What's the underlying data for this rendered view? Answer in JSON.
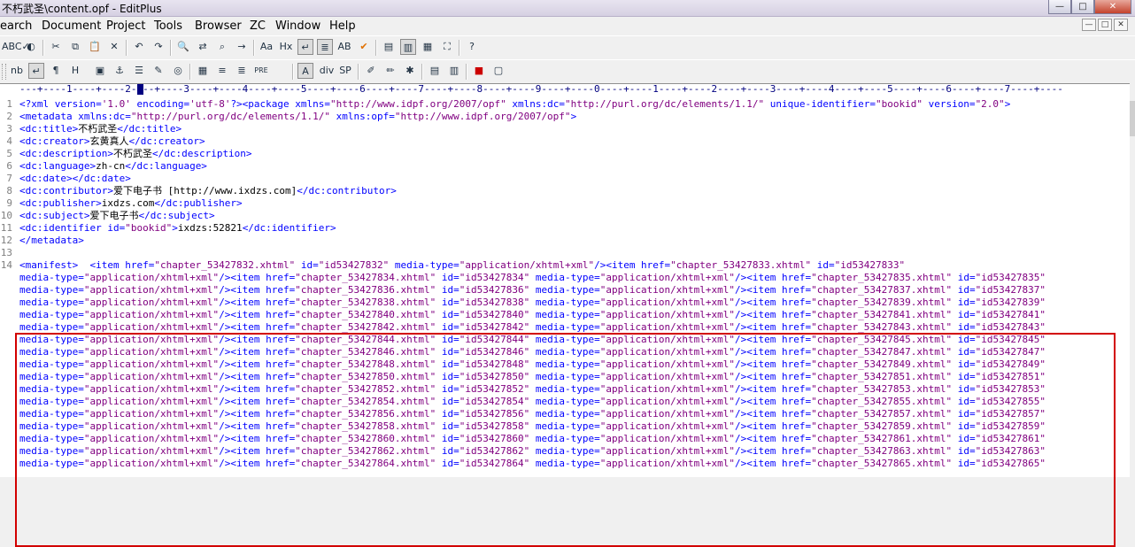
{
  "window": {
    "title": "不朽武圣\\content.opf - EditPlus",
    "controls": [
      "—",
      "□",
      "✕"
    ]
  },
  "menu": [
    "earch",
    "Document",
    "Project",
    "Tools",
    "Browser",
    "ZC",
    "Window",
    "Help"
  ],
  "mdi_controls": [
    "—",
    "□",
    "✕"
  ],
  "toolbar1": [
    {
      "name": "spellcheck-icon",
      "label": "ABC✓"
    },
    {
      "name": "browser-view-icon",
      "label": "◐"
    },
    {
      "name": "cut-icon",
      "label": "✂"
    },
    {
      "name": "copy-icon",
      "label": "⧉"
    },
    {
      "name": "paste-icon",
      "label": "📋"
    },
    {
      "name": "delete-icon",
      "label": "✕"
    },
    {
      "name": "undo-icon",
      "label": "↶"
    },
    {
      "name": "redo-icon",
      "label": "↷"
    },
    {
      "name": "find-icon",
      "label": "🔍"
    },
    {
      "name": "replace-icon",
      "label": "⇄"
    },
    {
      "name": "find-in-files-icon",
      "label": "⌕"
    },
    {
      "name": "goto-icon",
      "label": "→"
    },
    {
      "name": "font-icon",
      "label": "Aa"
    },
    {
      "name": "hex-viewer-icon",
      "label": "Hx"
    },
    {
      "name": "word-wrap-icon",
      "label": "↵"
    },
    {
      "name": "column-mode-icon",
      "label": "≣"
    },
    {
      "name": "sort-icon",
      "label": "AB"
    },
    {
      "name": "check-icon",
      "label": "✔"
    },
    {
      "name": "document-selector-icon",
      "label": "▤"
    },
    {
      "name": "output-window-icon",
      "label": "▥"
    },
    {
      "name": "cliptext-icon",
      "label": "▦"
    },
    {
      "name": "fullscreen-icon",
      "label": "⛶"
    },
    {
      "name": "help-icon",
      "label": "?"
    }
  ],
  "toolbar2": [
    {
      "name": "nbsp-icon",
      "label": "nb"
    },
    {
      "name": "br-icon",
      "label": "↵"
    },
    {
      "name": "paragraph-icon",
      "label": "¶"
    },
    {
      "name": "heading-icon",
      "label": "H"
    },
    {
      "name": "image-icon",
      "label": "▣"
    },
    {
      "name": "anchor-icon",
      "label": "⚓"
    },
    {
      "name": "hr-icon",
      "label": "☰"
    },
    {
      "name": "edit-icon",
      "label": "✎"
    },
    {
      "name": "color-icon",
      "label": "◎"
    },
    {
      "name": "table-icon",
      "label": "▦"
    },
    {
      "name": "list-icon",
      "label": "≡"
    },
    {
      "name": "center-icon",
      "label": "≣"
    },
    {
      "name": "pre-icon",
      "label": "PRE"
    },
    {
      "name": "font-tag-icon",
      "label": "A"
    },
    {
      "name": "div-icon",
      "label": "div"
    },
    {
      "name": "span-icon",
      "label": "SP"
    },
    {
      "name": "form-icon",
      "label": "✐"
    },
    {
      "name": "style-icon",
      "label": "✏"
    },
    {
      "name": "script-icon",
      "label": "✱"
    },
    {
      "name": "preview-icon",
      "label": "▤"
    },
    {
      "name": "frame-icon",
      "label": "▥"
    },
    {
      "name": "color-picker-icon",
      "label": "■"
    },
    {
      "name": "panel-icon",
      "label": "▢"
    }
  ],
  "ruler": "---+----1----+----2----+----3----+----4----+----5----+----6----+----7----+----8----+----9----+----0----+----1----+----2----+----3----+----4----+----5----+----6----+----7----+----",
  "line_numbers": [
    "1",
    "2",
    "3",
    "4",
    "5",
    "6",
    "7",
    "8",
    "9",
    "10",
    "11",
    "12",
    "13",
    "14"
  ],
  "colors": {
    "tag": "#0000ff",
    "attr": "#0000ff",
    "value": "#800080",
    "text": "#000000",
    "highlight_box": "#d20000"
  },
  "code_lines": [
    [
      [
        "tag",
        "<?xml version="
      ],
      [
        "value",
        "'1.0'"
      ],
      [
        "tag",
        " encoding="
      ],
      [
        "value",
        "'utf-8'"
      ],
      [
        "tag",
        "?><package xmlns="
      ],
      [
        "value",
        "\"http://www.idpf.org/2007/opf\""
      ],
      [
        "tag",
        " xmlns:dc="
      ],
      [
        "value",
        "\"http://purl.org/dc/elements/1.1/\""
      ],
      [
        "tag",
        " unique-identifier="
      ],
      [
        "value",
        "\"bookid\""
      ],
      [
        "tag",
        " version="
      ],
      [
        "value",
        "\"2.0\""
      ],
      [
        "tag",
        ">"
      ]
    ],
    [
      [
        "tag",
        "<metadata xmlns:dc="
      ],
      [
        "value",
        "\"http://purl.org/dc/elements/1.1/\""
      ],
      [
        "tag",
        " xmlns:opf="
      ],
      [
        "value",
        "\"http://www.idpf.org/2007/opf\""
      ],
      [
        "tag",
        ">"
      ]
    ],
    [
      [
        "tag",
        "<dc:title>"
      ],
      [
        "text",
        "不朽武圣"
      ],
      [
        "tag",
        "</dc:title>"
      ]
    ],
    [
      [
        "tag",
        "<dc:creator>"
      ],
      [
        "text",
        "玄黄真人"
      ],
      [
        "tag",
        "</dc:creator>"
      ]
    ],
    [
      [
        "tag",
        "<dc:description>"
      ],
      [
        "text",
        "不朽武圣"
      ],
      [
        "tag",
        "</dc:description>"
      ]
    ],
    [
      [
        "tag",
        "<dc:language>"
      ],
      [
        "text",
        "zh-cn"
      ],
      [
        "tag",
        "</dc:language>"
      ]
    ],
    [
      [
        "tag",
        "<dc:date></dc:date>"
      ]
    ],
    [
      [
        "tag",
        "<dc:contributor>"
      ],
      [
        "text",
        "爱下电子书 [http://www.ixdzs.com]"
      ],
      [
        "tag",
        "</dc:contributor>"
      ]
    ],
    [
      [
        "tag",
        "<dc:publisher>"
      ],
      [
        "text",
        "ixdzs.com"
      ],
      [
        "tag",
        "</dc:publisher>"
      ]
    ],
    [
      [
        "tag",
        "<dc:subject>"
      ],
      [
        "text",
        "爱下电子书"
      ],
      [
        "tag",
        "</dc:subject>"
      ]
    ],
    [
      [
        "tag",
        "<dc:identifier id="
      ],
      [
        "value",
        "\"bookid\""
      ],
      [
        "tag",
        ">"
      ],
      [
        "text",
        "ixdzs:52821"
      ],
      [
        "tag",
        "</dc:identifier>"
      ]
    ],
    [
      [
        "tag",
        "</metadata>"
      ]
    ],
    [],
    [
      [
        "tag",
        "<manifest>  <item href="
      ],
      [
        "value",
        "\"chapter_53427832.xhtml\""
      ],
      [
        "tag",
        " id="
      ],
      [
        "value",
        "\"id53427832\""
      ],
      [
        "tag",
        " media-type="
      ],
      [
        "value",
        "\"application/xhtml+xml\""
      ],
      [
        "tag",
        "/><item href="
      ],
      [
        "value",
        "\"chapter_53427833.xhtml\""
      ],
      [
        "tag",
        " id="
      ],
      [
        "value",
        "\"id53427833\""
      ]
    ],
    [
      [
        "tag",
        "media-type="
      ],
      [
        "value",
        "\"application/xhtml+xml\""
      ],
      [
        "tag",
        "/><item href="
      ],
      [
        "value",
        "\"chapter_53427834.xhtml\""
      ],
      [
        "tag",
        " id="
      ],
      [
        "value",
        "\"id53427834\""
      ],
      [
        "tag",
        " media-type="
      ],
      [
        "value",
        "\"application/xhtml+xml\""
      ],
      [
        "tag",
        "/><item href="
      ],
      [
        "value",
        "\"chapter_53427835.xhtml\""
      ],
      [
        "tag",
        " id="
      ],
      [
        "value",
        "\"id53427835\""
      ]
    ],
    [
      [
        "tag",
        "media-type="
      ],
      [
        "value",
        "\"application/xhtml+xml\""
      ],
      [
        "tag",
        "/><item href="
      ],
      [
        "value",
        "\"chapter_53427836.xhtml\""
      ],
      [
        "tag",
        " id="
      ],
      [
        "value",
        "\"id53427836\""
      ],
      [
        "tag",
        " media-type="
      ],
      [
        "value",
        "\"application/xhtml+xml\""
      ],
      [
        "tag",
        "/><item href="
      ],
      [
        "value",
        "\"chapter_53427837.xhtml\""
      ],
      [
        "tag",
        " id="
      ],
      [
        "value",
        "\"id53427837\""
      ]
    ],
    [
      [
        "tag",
        "media-type="
      ],
      [
        "value",
        "\"application/xhtml+xml\""
      ],
      [
        "tag",
        "/><item href="
      ],
      [
        "value",
        "\"chapter_53427838.xhtml\""
      ],
      [
        "tag",
        " id="
      ],
      [
        "value",
        "\"id53427838\""
      ],
      [
        "tag",
        " media-type="
      ],
      [
        "value",
        "\"application/xhtml+xml\""
      ],
      [
        "tag",
        "/><item href="
      ],
      [
        "value",
        "\"chapter_53427839.xhtml\""
      ],
      [
        "tag",
        " id="
      ],
      [
        "value",
        "\"id53427839\""
      ]
    ],
    [
      [
        "tag",
        "media-type="
      ],
      [
        "value",
        "\"application/xhtml+xml\""
      ],
      [
        "tag",
        "/><item href="
      ],
      [
        "value",
        "\"chapter_53427840.xhtml\""
      ],
      [
        "tag",
        " id="
      ],
      [
        "value",
        "\"id53427840\""
      ],
      [
        "tag",
        " media-type="
      ],
      [
        "value",
        "\"application/xhtml+xml\""
      ],
      [
        "tag",
        "/><item href="
      ],
      [
        "value",
        "\"chapter_53427841.xhtml\""
      ],
      [
        "tag",
        " id="
      ],
      [
        "value",
        "\"id53427841\""
      ]
    ],
    [
      [
        "tag",
        "media-type="
      ],
      [
        "value",
        "\"application/xhtml+xml\""
      ],
      [
        "tag",
        "/><item href="
      ],
      [
        "value",
        "\"chapter_53427842.xhtml\""
      ],
      [
        "tag",
        " id="
      ],
      [
        "value",
        "\"id53427842\""
      ],
      [
        "tag",
        " media-type="
      ],
      [
        "value",
        "\"application/xhtml+xml\""
      ],
      [
        "tag",
        "/><item href="
      ],
      [
        "value",
        "\"chapter_53427843.xhtml\""
      ],
      [
        "tag",
        " id="
      ],
      [
        "value",
        "\"id53427843\""
      ]
    ],
    [
      [
        "tag",
        "media-type="
      ],
      [
        "value",
        "\"application/xhtml+xml\""
      ],
      [
        "tag",
        "/><item href="
      ],
      [
        "value",
        "\"chapter_53427844.xhtml\""
      ],
      [
        "tag",
        " id="
      ],
      [
        "value",
        "\"id53427844\""
      ],
      [
        "tag",
        " media-type="
      ],
      [
        "value",
        "\"application/xhtml+xml\""
      ],
      [
        "tag",
        "/><item href="
      ],
      [
        "value",
        "\"chapter_53427845.xhtml\""
      ],
      [
        "tag",
        " id="
      ],
      [
        "value",
        "\"id53427845\""
      ]
    ],
    [
      [
        "tag",
        "media-type="
      ],
      [
        "value",
        "\"application/xhtml+xml\""
      ],
      [
        "tag",
        "/><item href="
      ],
      [
        "value",
        "\"chapter_53427846.xhtml\""
      ],
      [
        "tag",
        " id="
      ],
      [
        "value",
        "\"id53427846\""
      ],
      [
        "tag",
        " media-type="
      ],
      [
        "value",
        "\"application/xhtml+xml\""
      ],
      [
        "tag",
        "/><item href="
      ],
      [
        "value",
        "\"chapter_53427847.xhtml\""
      ],
      [
        "tag",
        " id="
      ],
      [
        "value",
        "\"id53427847\""
      ]
    ],
    [
      [
        "tag",
        "media-type="
      ],
      [
        "value",
        "\"application/xhtml+xml\""
      ],
      [
        "tag",
        "/><item href="
      ],
      [
        "value",
        "\"chapter_53427848.xhtml\""
      ],
      [
        "tag",
        " id="
      ],
      [
        "value",
        "\"id53427848\""
      ],
      [
        "tag",
        " media-type="
      ],
      [
        "value",
        "\"application/xhtml+xml\""
      ],
      [
        "tag",
        "/><item href="
      ],
      [
        "value",
        "\"chapter_53427849.xhtml\""
      ],
      [
        "tag",
        " id="
      ],
      [
        "value",
        "\"id53427849\""
      ]
    ],
    [
      [
        "tag",
        "media-type="
      ],
      [
        "value",
        "\"application/xhtml+xml\""
      ],
      [
        "tag",
        "/><item href="
      ],
      [
        "value",
        "\"chapter_53427850.xhtml\""
      ],
      [
        "tag",
        " id="
      ],
      [
        "value",
        "\"id53427850\""
      ],
      [
        "tag",
        " media-type="
      ],
      [
        "value",
        "\"application/xhtml+xml\""
      ],
      [
        "tag",
        "/><item href="
      ],
      [
        "value",
        "\"chapter_53427851.xhtml\""
      ],
      [
        "tag",
        " id="
      ],
      [
        "value",
        "\"id53427851\""
      ]
    ],
    [
      [
        "tag",
        "media-type="
      ],
      [
        "value",
        "\"application/xhtml+xml\""
      ],
      [
        "tag",
        "/><item href="
      ],
      [
        "value",
        "\"chapter_53427852.xhtml\""
      ],
      [
        "tag",
        " id="
      ],
      [
        "value",
        "\"id53427852\""
      ],
      [
        "tag",
        " media-type="
      ],
      [
        "value",
        "\"application/xhtml+xml\""
      ],
      [
        "tag",
        "/><item href="
      ],
      [
        "value",
        "\"chapter_53427853.xhtml\""
      ],
      [
        "tag",
        " id="
      ],
      [
        "value",
        "\"id53427853\""
      ]
    ],
    [
      [
        "tag",
        "media-type="
      ],
      [
        "value",
        "\"application/xhtml+xml\""
      ],
      [
        "tag",
        "/><item href="
      ],
      [
        "value",
        "\"chapter_53427854.xhtml\""
      ],
      [
        "tag",
        " id="
      ],
      [
        "value",
        "\"id53427854\""
      ],
      [
        "tag",
        " media-type="
      ],
      [
        "value",
        "\"application/xhtml+xml\""
      ],
      [
        "tag",
        "/><item href="
      ],
      [
        "value",
        "\"chapter_53427855.xhtml\""
      ],
      [
        "tag",
        " id="
      ],
      [
        "value",
        "\"id53427855\""
      ]
    ],
    [
      [
        "tag",
        "media-type="
      ],
      [
        "value",
        "\"application/xhtml+xml\""
      ],
      [
        "tag",
        "/><item href="
      ],
      [
        "value",
        "\"chapter_53427856.xhtml\""
      ],
      [
        "tag",
        " id="
      ],
      [
        "value",
        "\"id53427856\""
      ],
      [
        "tag",
        " media-type="
      ],
      [
        "value",
        "\"application/xhtml+xml\""
      ],
      [
        "tag",
        "/><item href="
      ],
      [
        "value",
        "\"chapter_53427857.xhtml\""
      ],
      [
        "tag",
        " id="
      ],
      [
        "value",
        "\"id53427857\""
      ]
    ],
    [
      [
        "tag",
        "media-type="
      ],
      [
        "value",
        "\"application/xhtml+xml\""
      ],
      [
        "tag",
        "/><item href="
      ],
      [
        "value",
        "\"chapter_53427858.xhtml\""
      ],
      [
        "tag",
        " id="
      ],
      [
        "value",
        "\"id53427858\""
      ],
      [
        "tag",
        " media-type="
      ],
      [
        "value",
        "\"application/xhtml+xml\""
      ],
      [
        "tag",
        "/><item href="
      ],
      [
        "value",
        "\"chapter_53427859.xhtml\""
      ],
      [
        "tag",
        " id="
      ],
      [
        "value",
        "\"id53427859\""
      ]
    ],
    [
      [
        "tag",
        "media-type="
      ],
      [
        "value",
        "\"application/xhtml+xml\""
      ],
      [
        "tag",
        "/><item href="
      ],
      [
        "value",
        "\"chapter_53427860.xhtml\""
      ],
      [
        "tag",
        " id="
      ],
      [
        "value",
        "\"id53427860\""
      ],
      [
        "tag",
        " media-type="
      ],
      [
        "value",
        "\"application/xhtml+xml\""
      ],
      [
        "tag",
        "/><item href="
      ],
      [
        "value",
        "\"chapter_53427861.xhtml\""
      ],
      [
        "tag",
        " id="
      ],
      [
        "value",
        "\"id53427861\""
      ]
    ],
    [
      [
        "tag",
        "media-type="
      ],
      [
        "value",
        "\"application/xhtml+xml\""
      ],
      [
        "tag",
        "/><item href="
      ],
      [
        "value",
        "\"chapter_53427862.xhtml\""
      ],
      [
        "tag",
        " id="
      ],
      [
        "value",
        "\"id53427862\""
      ],
      [
        "tag",
        " media-type="
      ],
      [
        "value",
        "\"application/xhtml+xml\""
      ],
      [
        "tag",
        "/><item href="
      ],
      [
        "value",
        "\"chapter_53427863.xhtml\""
      ],
      [
        "tag",
        " id="
      ],
      [
        "value",
        "\"id53427863\""
      ]
    ],
    [
      [
        "tag",
        "media-type="
      ],
      [
        "value",
        "\"application/xhtml+xml\""
      ],
      [
        "tag",
        "/><item href="
      ],
      [
        "value",
        "\"chapter_53427864.xhtml\""
      ],
      [
        "tag",
        " id="
      ],
      [
        "value",
        "\"id53427864\""
      ],
      [
        "tag",
        " media-type="
      ],
      [
        "value",
        "\"application/xhtml+xml\""
      ],
      [
        "tag",
        "/><item href="
      ],
      [
        "value",
        "\"chapter_53427865.xhtml\""
      ],
      [
        "tag",
        " id="
      ],
      [
        "value",
        "\"id53427865\""
      ]
    ]
  ]
}
